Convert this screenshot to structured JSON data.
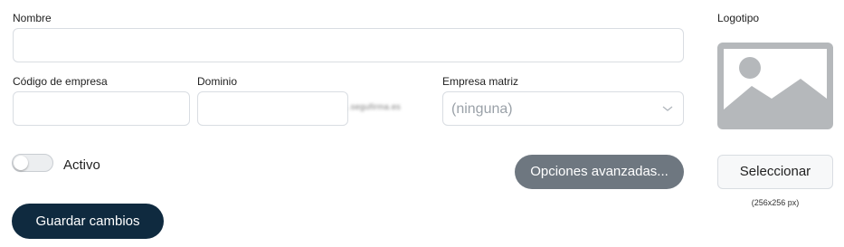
{
  "form": {
    "name_label": "Nombre",
    "name_value": "",
    "company_code_label": "Código de empresa",
    "company_code_value": "",
    "domain_label": "Dominio",
    "domain_value": "",
    "domain_suffix": ".segufirma.es",
    "parent_label": "Empresa matriz",
    "parent_value": "(ninguna)",
    "active_label": "Activo",
    "active_on": false,
    "advanced_button": "Opciones avanzadas...",
    "save_button": "Guardar cambios"
  },
  "logo": {
    "label": "Logotipo",
    "placeholder_icon": "image-placeholder-icon",
    "select_button": "Seleccionar",
    "size_hint": "(256x256 px)"
  },
  "colors": {
    "primary": "#0f2a3f",
    "secondary": "#6e7780",
    "placeholder": "#b5b8bb"
  }
}
